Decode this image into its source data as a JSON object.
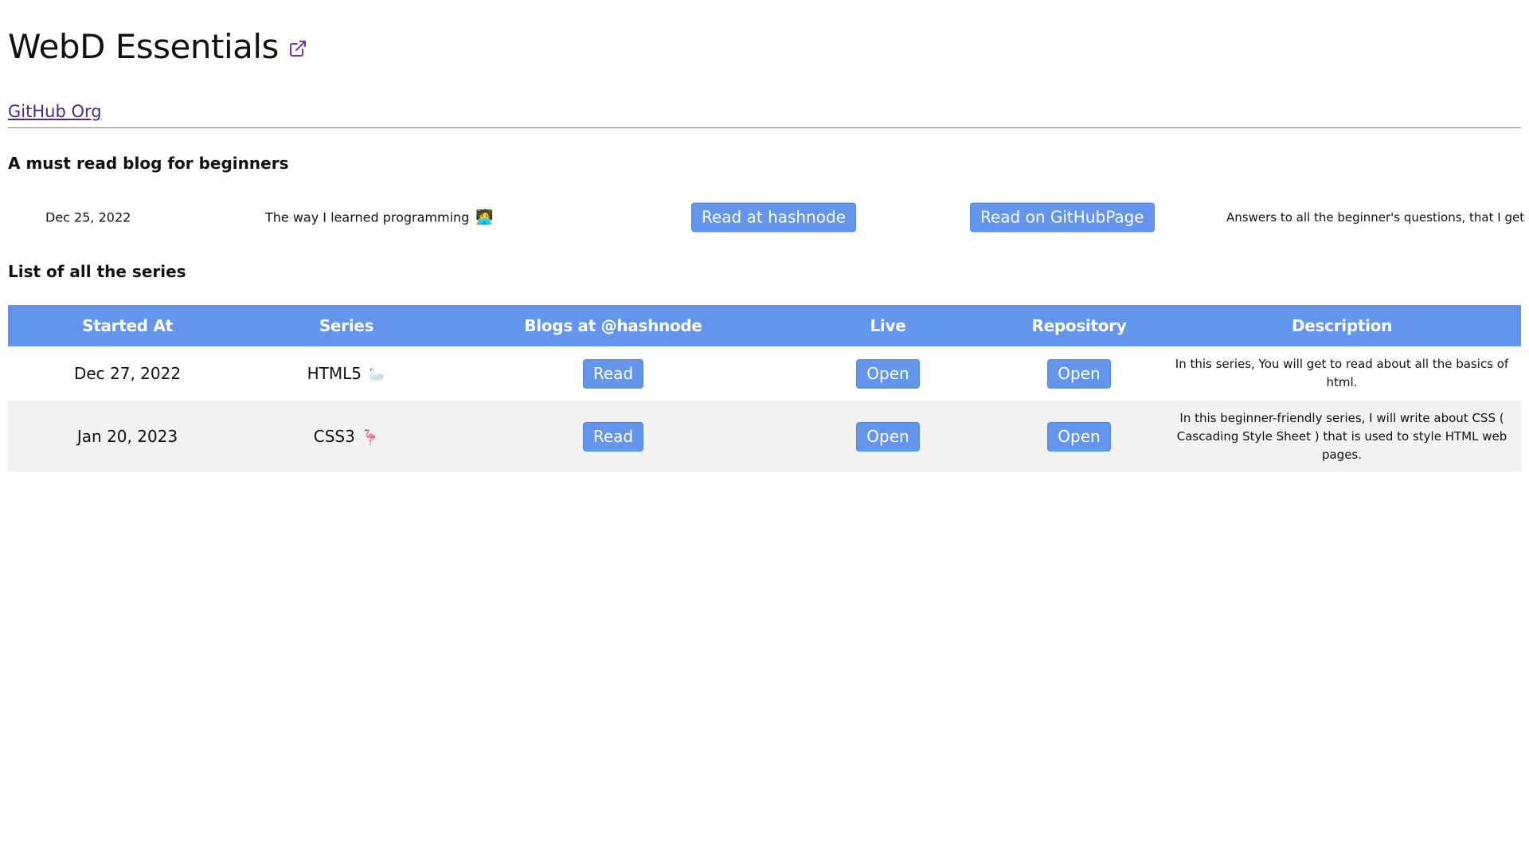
{
  "header": {
    "title": "WebD Essentials",
    "title_icon": "external-link-icon",
    "org_link": "GitHub Org"
  },
  "featured": {
    "heading": "A must read blog for beginners",
    "date": "Dec 25, 2022",
    "title": "The way I learned programming",
    "emoji": "🧑‍💻",
    "hashnode_button": "Read at hashnode",
    "github_button": "Read on GitHubPage",
    "description": "Answers to all the beginner's questions, that I get"
  },
  "series": {
    "heading": "List of all the series",
    "columns": [
      "Started At",
      "Series",
      "Blogs at @hashnode",
      "Live",
      "Repository",
      "Description"
    ],
    "rows": [
      {
        "started": "Dec 27, 2022",
        "name": "HTML5",
        "emoji": "🦢",
        "blog_button": "Read",
        "live_button": "Open",
        "repo_button": "Open",
        "description": "In this series, You will get to read about all the basics of html."
      },
      {
        "started": "Jan 20, 2023",
        "name": "CSS3",
        "emoji": "🦩",
        "blog_button": "Read",
        "live_button": "Open",
        "repo_button": "Open",
        "description": "In this beginner-friendly series, I will write about CSS ( Cascading Style Sheet ) that is used to style HTML web pages."
      }
    ]
  },
  "colors": {
    "accent": "#6495ed",
    "link": "#4b2a8a",
    "icon": "#7b2fb3",
    "row_alt": "#f2f2f2"
  }
}
